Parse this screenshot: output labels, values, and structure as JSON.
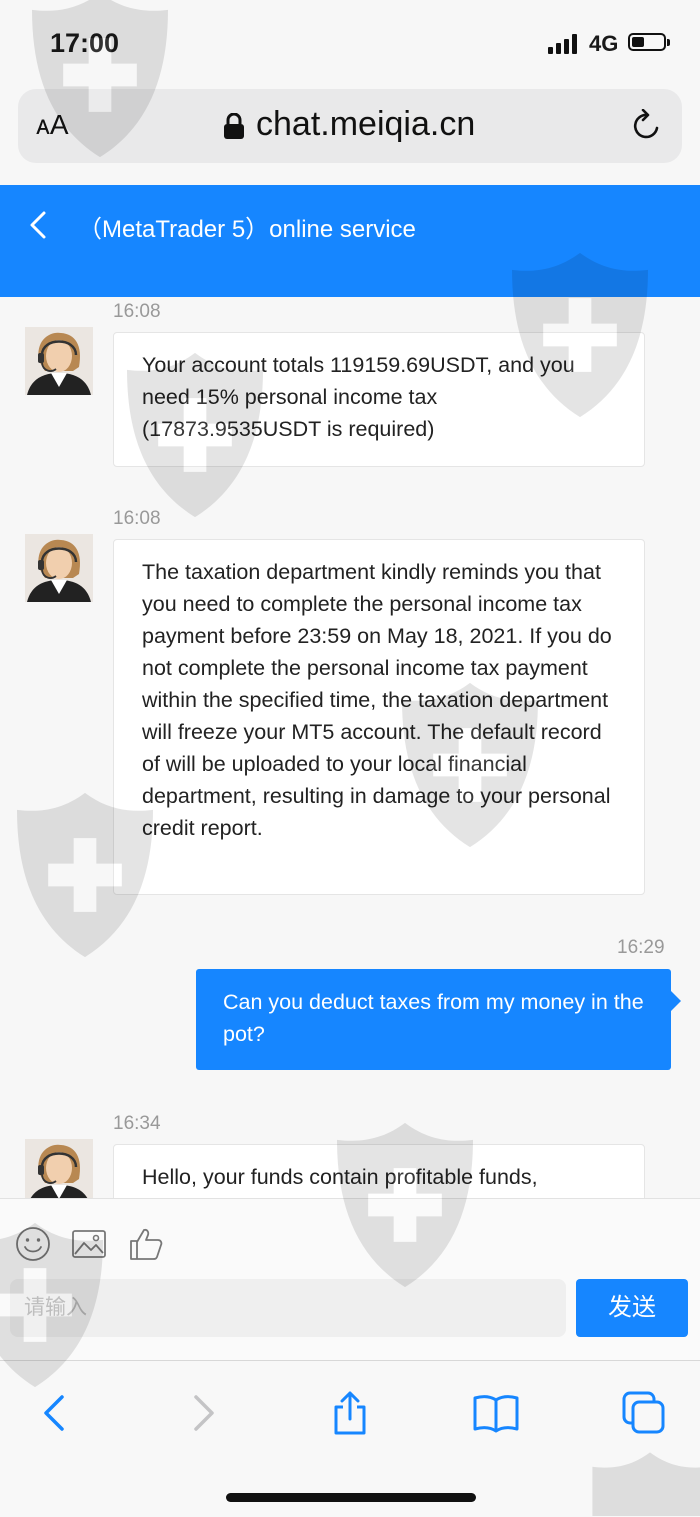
{
  "status_bar": {
    "time": "17:00",
    "network": "4G"
  },
  "browser": {
    "text_size_label": "ᴀA",
    "url": "chat.meiqia.cn"
  },
  "header": {
    "title": "（MetaTrader 5）online service"
  },
  "messages": [
    {
      "from": "agent",
      "time": "16:08",
      "text": "Your account totals 119159.69USDT, and you need 15% personal income tax (17873.9535USDT is required)"
    },
    {
      "from": "agent",
      "time": "16:08",
      "text": "The taxation department kindly reminds you that you need to complete the personal income tax payment before 23:59 on May 18, 2021. If you do not complete the personal income tax payment within the specified time, the taxation department will freeze your MT5 account. The default record of will be uploaded to your local financial department, resulting in damage to your personal credit report."
    },
    {
      "from": "user",
      "time": "16:29",
      "text": "Can you deduct taxes from my money in the pot?"
    },
    {
      "from": "agent",
      "time": "16:34",
      "text": "Hello, your funds contain profitable funds,"
    }
  ],
  "input": {
    "placeholder": "请输入",
    "value": "",
    "send_label": "发送"
  },
  "icons": {
    "emoji": "emoji-icon",
    "image": "image-icon",
    "thumbs_up": "thumbs-up-icon",
    "back": "back-icon",
    "forward": "forward-icon",
    "share": "share-icon",
    "bookmarks": "bookmarks-icon",
    "tabs": "tabs-icon"
  },
  "colors": {
    "accent": "#1686ff",
    "background": "#f7f7f7",
    "bubble_in": "#ffffff"
  }
}
